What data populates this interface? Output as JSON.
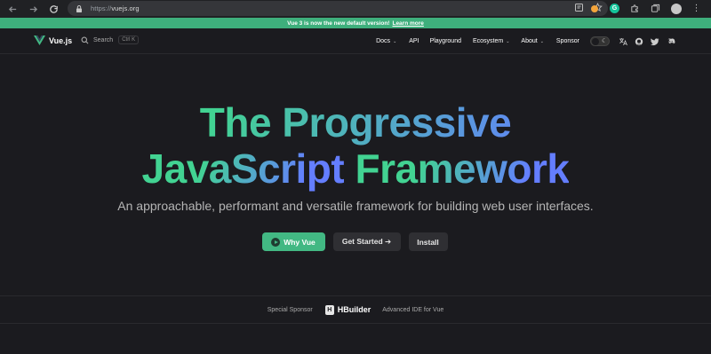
{
  "browser": {
    "url_scheme": "https://",
    "url_host": "vuejs.org"
  },
  "banner": {
    "text": "Vue 3 is now the new default version!",
    "link": "Learn more"
  },
  "nav": {
    "brand": "Vue.js",
    "search_label": "Search",
    "search_shortcut": "Ctrl K",
    "items": [
      {
        "label": "Docs",
        "dropdown": true
      },
      {
        "label": "API",
        "dropdown": false
      },
      {
        "label": "Playground",
        "dropdown": false
      },
      {
        "label": "Ecosystem",
        "dropdown": true
      },
      {
        "label": "About",
        "dropdown": true
      },
      {
        "label": "Sponsor",
        "dropdown": false
      }
    ]
  },
  "hero": {
    "title_line1": "The Progressive",
    "title_line2_a": "JavaScript",
    "title_line2_b": "Framework",
    "tagline": "An approachable, performant and versatile framework for building web user interfaces.",
    "buttons": {
      "why": "Why Vue",
      "start": "Get Started ➔",
      "install": "Install"
    }
  },
  "sponsor": {
    "label": "Special Sponsor",
    "name": "HBuilder",
    "desc": "Advanced IDE for Vue"
  },
  "colors": {
    "vue_green": "#42b883",
    "banner": "#3eaf7c",
    "grad_start": "#42d392",
    "grad_end": "#647eff"
  }
}
